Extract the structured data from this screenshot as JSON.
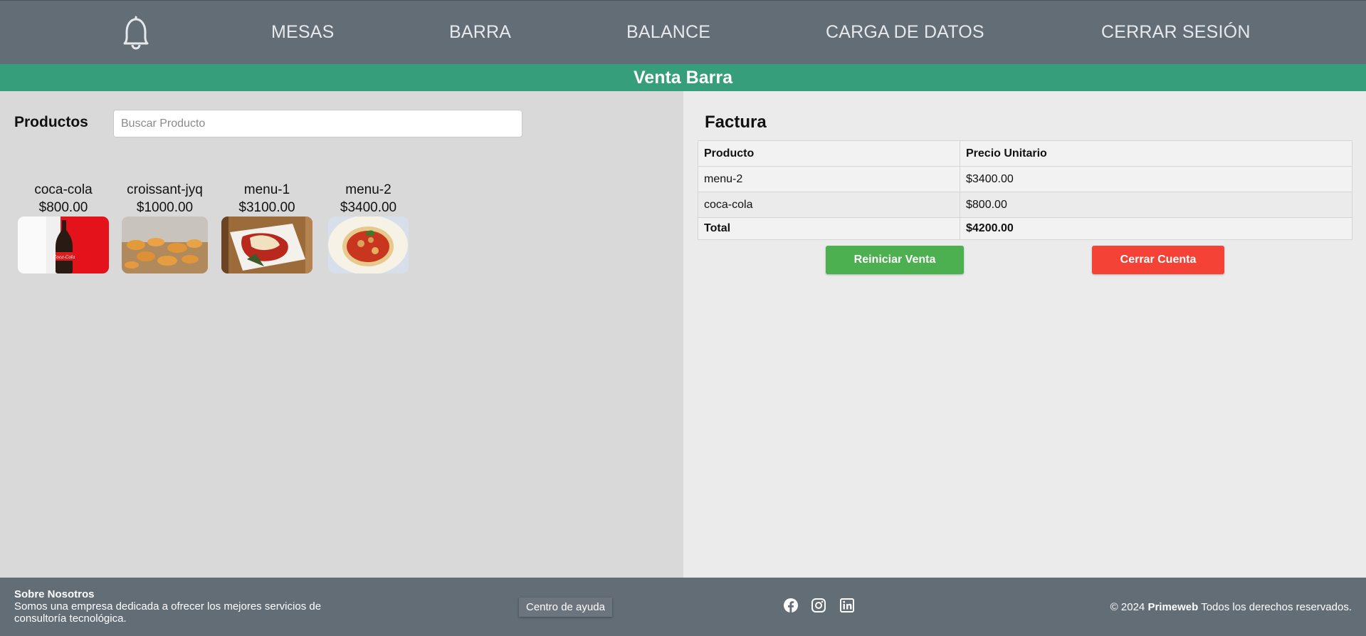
{
  "nav": {
    "bell_icon": "bell-icon",
    "items": [
      "MESAS",
      "BARRA",
      "BALANCE",
      "CARGA DE DATOS",
      "CERRAR SESIÓN"
    ]
  },
  "banner": {
    "title": "Venta Barra"
  },
  "products": {
    "title": "Productos",
    "search_placeholder": "Buscar Producto",
    "items": [
      {
        "name": "coca-cola",
        "price": "$800.00"
      },
      {
        "name": "croissant-jyq",
        "price": "$1000.00"
      },
      {
        "name": "menu-1",
        "price": "$3100.00"
      },
      {
        "name": "menu-2",
        "price": "$3400.00"
      }
    ]
  },
  "invoice": {
    "title": "Factura",
    "headers": [
      "Producto",
      "Precio Unitario"
    ],
    "rows": [
      [
        "menu-2",
        "$3400.00"
      ],
      [
        "coca-cola",
        "$800.00"
      ]
    ],
    "total_label": "Total",
    "total_value": "$4200.00",
    "reset_label": "Reiniciar Venta",
    "close_label": "Cerrar Cuenta"
  },
  "footer": {
    "about_title": "Sobre Nosotros",
    "about_text": "Somos una empresa dedicada a ofrecer los mejores servicios de consultoría tecnológica.",
    "help_label": "Centro de ayuda",
    "social_icons": [
      "facebook-icon",
      "instagram-icon",
      "linkedin-icon"
    ],
    "copyright_prefix": "© 2024",
    "copyright_brand": "Primeweb",
    "copyright_suffix": "Todos los derechos reservados."
  },
  "colors": {
    "nav_bg": "#636d76",
    "banner_bg": "#379e7c",
    "reset_button": "#4caf50",
    "close_button": "#f44336"
  }
}
